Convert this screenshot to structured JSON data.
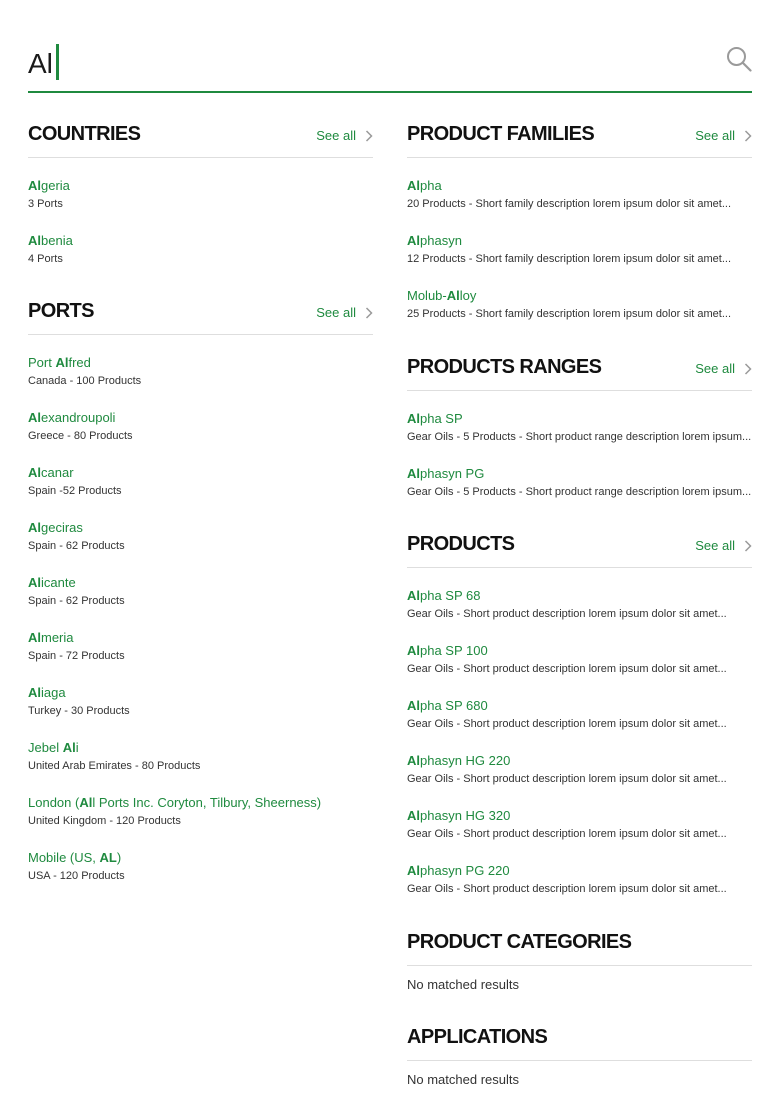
{
  "search": {
    "query": "Al"
  },
  "see_all_label": "See all",
  "countries": {
    "title": "COUNTRIES",
    "items": [
      {
        "pre": "",
        "match": "Al",
        "post": "geria",
        "sub": "3 Ports"
      },
      {
        "pre": "",
        "match": "Al",
        "post": "benia",
        "sub": "4 Ports"
      }
    ]
  },
  "ports": {
    "title": "PORTS",
    "items": [
      {
        "pre": "Port ",
        "match": "Al",
        "post": "fred",
        "sub": "Canada - 100 Products"
      },
      {
        "pre": "",
        "match": "Al",
        "post": "exandroupoli",
        "sub": "Greece - 80 Products"
      },
      {
        "pre": "",
        "match": "Al",
        "post": "canar",
        "sub": "Spain -52 Products"
      },
      {
        "pre": "",
        "match": "Al",
        "post": "geciras",
        "sub": "Spain - 62 Products"
      },
      {
        "pre": "",
        "match": "Al",
        "post": "icante",
        "sub": "Spain - 62 Products"
      },
      {
        "pre": "",
        "match": "Al",
        "post": "meria",
        "sub": "Spain - 72 Products"
      },
      {
        "pre": "",
        "match": "Al",
        "post": "iaga",
        "sub": "Turkey - 30 Products"
      },
      {
        "pre": "Jebel ",
        "match": "Al",
        "post": "i",
        "sub": "United Arab Emirates - 80 Products"
      },
      {
        "pre": "London (",
        "match": "Al",
        "post": "l Ports Inc. Coryton, Tilbury, Sheerness)",
        "sub": "United Kingdom - 120 Products"
      },
      {
        "pre": "Mobile (US, ",
        "match": "AL",
        "post": ")",
        "sub": "USA - 120 Products"
      }
    ]
  },
  "product_families": {
    "title": "PRODUCT FAMILIES",
    "items": [
      {
        "pre": "",
        "match": "Al",
        "post": "pha",
        "sub": "20 Products - Short family description lorem ipsum dolor sit amet..."
      },
      {
        "pre": "",
        "match": "Al",
        "post": "phasyn",
        "sub": "12 Products - Short family description lorem ipsum dolor sit amet..."
      },
      {
        "pre": "Molub-",
        "match": "Al",
        "post": "loy",
        "sub": "25 Products - Short family description lorem ipsum dolor sit amet..."
      }
    ]
  },
  "product_ranges": {
    "title": "PRODUCTS RANGES",
    "items": [
      {
        "pre": "",
        "match": "Al",
        "post": "pha SP",
        "sub": "Gear Oils - 5 Products - Short product range description lorem ipsum..."
      },
      {
        "pre": "",
        "match": "Al",
        "post": "phasyn PG",
        "sub": "Gear Oils - 5 Products - Short product range description lorem ipsum..."
      }
    ]
  },
  "products": {
    "title": "PRODUCTS",
    "items": [
      {
        "pre": "",
        "match": "Al",
        "post": "pha SP 68",
        "sub": "Gear Oils - Short product description lorem ipsum dolor sit amet..."
      },
      {
        "pre": "",
        "match": "Al",
        "post": "pha SP 100",
        "sub": "Gear Oils - Short product description lorem ipsum dolor sit amet..."
      },
      {
        "pre": "",
        "match": "Al",
        "post": "pha SP 680",
        "sub": "Gear Oils - Short product description lorem ipsum dolor sit amet..."
      },
      {
        "pre": "",
        "match": "Al",
        "post": "phasyn HG 220",
        "sub": "Gear Oils - Short product description lorem ipsum dolor sit amet..."
      },
      {
        "pre": "",
        "match": "Al",
        "post": "phasyn HG 320",
        "sub": "Gear Oils - Short product description lorem ipsum dolor sit amet..."
      },
      {
        "pre": "",
        "match": "Al",
        "post": "phasyn PG 220",
        "sub": "Gear Oils - Short product description lorem ipsum dolor sit amet..."
      }
    ]
  },
  "product_categories": {
    "title": "PRODUCT CATEGORIES",
    "empty": "No matched results"
  },
  "applications": {
    "title": "APPLICATIONS",
    "empty": "No matched results"
  },
  "colors": {
    "accent": "#1f8a3f",
    "divider": "#dedede",
    "text": "#1a1a1a"
  }
}
